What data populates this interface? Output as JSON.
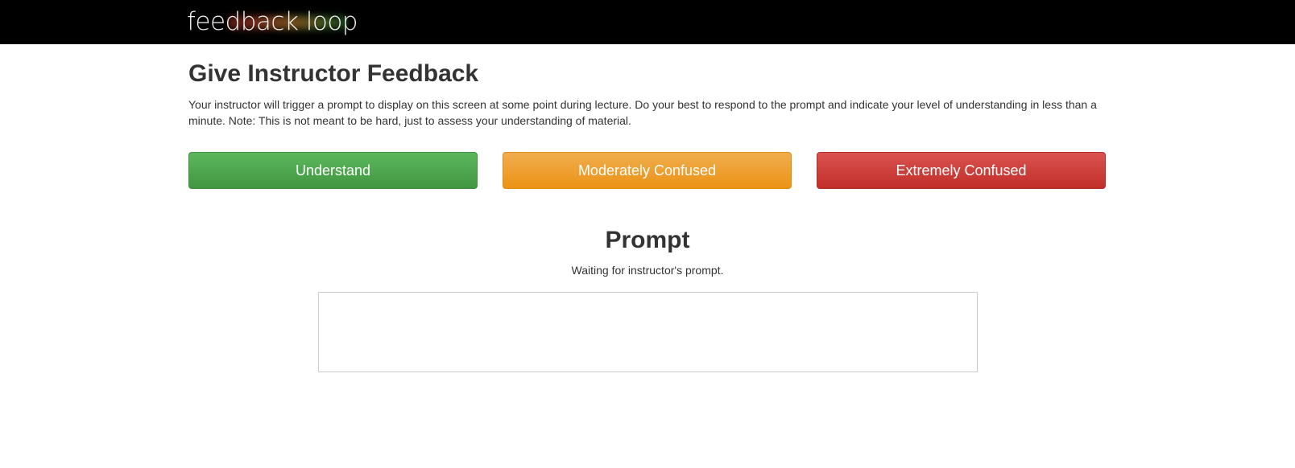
{
  "navbar": {
    "logo_text": "feedback loop",
    "background_color": "#000000"
  },
  "main": {
    "title": "Give Instructor Feedback",
    "description": "Your instructor will trigger a prompt to display on this screen at some point during lecture. Do your best to respond to the prompt and indicate your level of understanding in less than a minute. Note: This is not meant to be hard, just to assess your understanding of material.",
    "buttons": [
      {
        "label": "Understand",
        "color": "#5cb85c"
      },
      {
        "label": "Moderately Confused",
        "color": "#f0ad4e"
      },
      {
        "label": "Extremely Confused",
        "color": "#d9534f"
      }
    ]
  },
  "prompt": {
    "title": "Prompt",
    "status": "Waiting for instructor's prompt."
  }
}
